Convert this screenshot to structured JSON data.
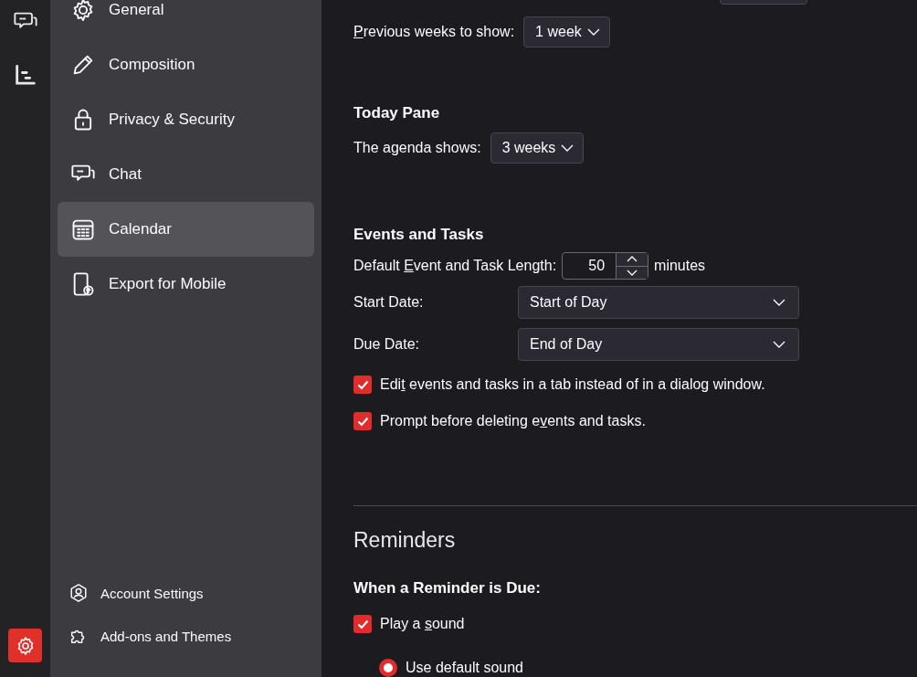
{
  "spaces": [
    {
      "kind": "chat",
      "selected": false
    },
    {
      "kind": "tasks",
      "selected": false
    },
    {
      "kind": "settings",
      "selected": true
    }
  ],
  "sidebar": {
    "items": [
      {
        "kind": "gear",
        "label": "General",
        "selected": false
      },
      {
        "kind": "pencil",
        "label": "Composition",
        "selected": false
      },
      {
        "kind": "lock",
        "label": "Privacy & Security",
        "selected": false
      },
      {
        "kind": "chat",
        "label": "Chat",
        "selected": false
      },
      {
        "kind": "calendar",
        "label": "Calendar",
        "selected": true
      },
      {
        "kind": "mobile",
        "label": "Export for Mobile",
        "selected": false
      }
    ],
    "footer": [
      {
        "kind": "account",
        "label": "Account Settings"
      },
      {
        "kind": "puzzle",
        "label": "Add-ons and Themes"
      }
    ]
  },
  "content": {
    "previous_weeks": {
      "label": {
        "key": "P",
        "after": "revious weeks to show:"
      },
      "value": "1 week"
    },
    "today_pane": {
      "title": "Today Pane",
      "agenda": {
        "label": "The agenda shows:",
        "value": "3 weeks"
      }
    },
    "events_tasks": {
      "title": "Events and Tasks",
      "length": {
        "label": {
          "before": "Default ",
          "key": "E",
          "after": "vent and Task Length:"
        },
        "value": "50",
        "unit": "minutes"
      },
      "start_date": {
        "label": "Start Date:",
        "value": "Start of Day"
      },
      "due_date": {
        "label": "Due Date:",
        "value": "End of Day"
      },
      "checkboxes": [
        {
          "label": {
            "before": "Edi",
            "key": "t",
            "after": " events and tasks in a tab instead of in a dialog window."
          },
          "checked": true
        },
        {
          "label": {
            "before": "Prompt before deleting e",
            "key": "v",
            "after": "ents and tasks."
          },
          "checked": true
        }
      ]
    },
    "reminders": {
      "title": "Reminders",
      "subtitle": "When a Reminder is Due:",
      "play_sound": {
        "label": {
          "before": "Play a ",
          "key": "s",
          "after": "ound"
        },
        "checked": true
      },
      "sound_options": [
        {
          "label": "Use default sound",
          "selected": true
        }
      ]
    }
  }
}
